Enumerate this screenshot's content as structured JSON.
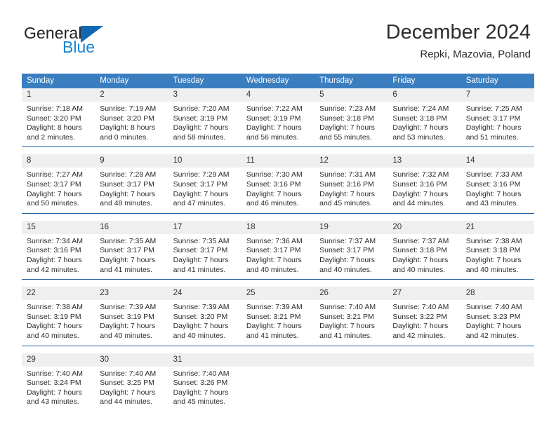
{
  "brand": {
    "name_part1": "General",
    "name_part2": "Blue",
    "triangle_color": "#1267b2",
    "blue_color": "#1982d1"
  },
  "header": {
    "title": "December 2024",
    "location": "Repki, Mazovia, Poland"
  },
  "theme": {
    "header_bg": "#3a7ec0",
    "week_separator": "#1f5fa0",
    "daynum_bg": "#efefef",
    "text": "#2b2b2b"
  },
  "weekdays": [
    "Sunday",
    "Monday",
    "Tuesday",
    "Wednesday",
    "Thursday",
    "Friday",
    "Saturday"
  ],
  "weeks": [
    [
      {
        "day": "1",
        "sunrise": "Sunrise: 7:18 AM",
        "sunset": "Sunset: 3:20 PM",
        "daylight1": "Daylight: 8 hours",
        "daylight2": "and 2 minutes."
      },
      {
        "day": "2",
        "sunrise": "Sunrise: 7:19 AM",
        "sunset": "Sunset: 3:20 PM",
        "daylight1": "Daylight: 8 hours",
        "daylight2": "and 0 minutes."
      },
      {
        "day": "3",
        "sunrise": "Sunrise: 7:20 AM",
        "sunset": "Sunset: 3:19 PM",
        "daylight1": "Daylight: 7 hours",
        "daylight2": "and 58 minutes."
      },
      {
        "day": "4",
        "sunrise": "Sunrise: 7:22 AM",
        "sunset": "Sunset: 3:19 PM",
        "daylight1": "Daylight: 7 hours",
        "daylight2": "and 56 minutes."
      },
      {
        "day": "5",
        "sunrise": "Sunrise: 7:23 AM",
        "sunset": "Sunset: 3:18 PM",
        "daylight1": "Daylight: 7 hours",
        "daylight2": "and 55 minutes."
      },
      {
        "day": "6",
        "sunrise": "Sunrise: 7:24 AM",
        "sunset": "Sunset: 3:18 PM",
        "daylight1": "Daylight: 7 hours",
        "daylight2": "and 53 minutes."
      },
      {
        "day": "7",
        "sunrise": "Sunrise: 7:25 AM",
        "sunset": "Sunset: 3:17 PM",
        "daylight1": "Daylight: 7 hours",
        "daylight2": "and 51 minutes."
      }
    ],
    [
      {
        "day": "8",
        "sunrise": "Sunrise: 7:27 AM",
        "sunset": "Sunset: 3:17 PM",
        "daylight1": "Daylight: 7 hours",
        "daylight2": "and 50 minutes."
      },
      {
        "day": "9",
        "sunrise": "Sunrise: 7:28 AM",
        "sunset": "Sunset: 3:17 PM",
        "daylight1": "Daylight: 7 hours",
        "daylight2": "and 48 minutes."
      },
      {
        "day": "10",
        "sunrise": "Sunrise: 7:29 AM",
        "sunset": "Sunset: 3:17 PM",
        "daylight1": "Daylight: 7 hours",
        "daylight2": "and 47 minutes."
      },
      {
        "day": "11",
        "sunrise": "Sunrise: 7:30 AM",
        "sunset": "Sunset: 3:16 PM",
        "daylight1": "Daylight: 7 hours",
        "daylight2": "and 46 minutes."
      },
      {
        "day": "12",
        "sunrise": "Sunrise: 7:31 AM",
        "sunset": "Sunset: 3:16 PM",
        "daylight1": "Daylight: 7 hours",
        "daylight2": "and 45 minutes."
      },
      {
        "day": "13",
        "sunrise": "Sunrise: 7:32 AM",
        "sunset": "Sunset: 3:16 PM",
        "daylight1": "Daylight: 7 hours",
        "daylight2": "and 44 minutes."
      },
      {
        "day": "14",
        "sunrise": "Sunrise: 7:33 AM",
        "sunset": "Sunset: 3:16 PM",
        "daylight1": "Daylight: 7 hours",
        "daylight2": "and 43 minutes."
      }
    ],
    [
      {
        "day": "15",
        "sunrise": "Sunrise: 7:34 AM",
        "sunset": "Sunset: 3:16 PM",
        "daylight1": "Daylight: 7 hours",
        "daylight2": "and 42 minutes."
      },
      {
        "day": "16",
        "sunrise": "Sunrise: 7:35 AM",
        "sunset": "Sunset: 3:17 PM",
        "daylight1": "Daylight: 7 hours",
        "daylight2": "and 41 minutes."
      },
      {
        "day": "17",
        "sunrise": "Sunrise: 7:35 AM",
        "sunset": "Sunset: 3:17 PM",
        "daylight1": "Daylight: 7 hours",
        "daylight2": "and 41 minutes."
      },
      {
        "day": "18",
        "sunrise": "Sunrise: 7:36 AM",
        "sunset": "Sunset: 3:17 PM",
        "daylight1": "Daylight: 7 hours",
        "daylight2": "and 40 minutes."
      },
      {
        "day": "19",
        "sunrise": "Sunrise: 7:37 AM",
        "sunset": "Sunset: 3:17 PM",
        "daylight1": "Daylight: 7 hours",
        "daylight2": "and 40 minutes."
      },
      {
        "day": "20",
        "sunrise": "Sunrise: 7:37 AM",
        "sunset": "Sunset: 3:18 PM",
        "daylight1": "Daylight: 7 hours",
        "daylight2": "and 40 minutes."
      },
      {
        "day": "21",
        "sunrise": "Sunrise: 7:38 AM",
        "sunset": "Sunset: 3:18 PM",
        "daylight1": "Daylight: 7 hours",
        "daylight2": "and 40 minutes."
      }
    ],
    [
      {
        "day": "22",
        "sunrise": "Sunrise: 7:38 AM",
        "sunset": "Sunset: 3:19 PM",
        "daylight1": "Daylight: 7 hours",
        "daylight2": "and 40 minutes."
      },
      {
        "day": "23",
        "sunrise": "Sunrise: 7:39 AM",
        "sunset": "Sunset: 3:19 PM",
        "daylight1": "Daylight: 7 hours",
        "daylight2": "and 40 minutes."
      },
      {
        "day": "24",
        "sunrise": "Sunrise: 7:39 AM",
        "sunset": "Sunset: 3:20 PM",
        "daylight1": "Daylight: 7 hours",
        "daylight2": "and 40 minutes."
      },
      {
        "day": "25",
        "sunrise": "Sunrise: 7:39 AM",
        "sunset": "Sunset: 3:21 PM",
        "daylight1": "Daylight: 7 hours",
        "daylight2": "and 41 minutes."
      },
      {
        "day": "26",
        "sunrise": "Sunrise: 7:40 AM",
        "sunset": "Sunset: 3:21 PM",
        "daylight1": "Daylight: 7 hours",
        "daylight2": "and 41 minutes."
      },
      {
        "day": "27",
        "sunrise": "Sunrise: 7:40 AM",
        "sunset": "Sunset: 3:22 PM",
        "daylight1": "Daylight: 7 hours",
        "daylight2": "and 42 minutes."
      },
      {
        "day": "28",
        "sunrise": "Sunrise: 7:40 AM",
        "sunset": "Sunset: 3:23 PM",
        "daylight1": "Daylight: 7 hours",
        "daylight2": "and 42 minutes."
      }
    ],
    [
      {
        "day": "29",
        "sunrise": "Sunrise: 7:40 AM",
        "sunset": "Sunset: 3:24 PM",
        "daylight1": "Daylight: 7 hours",
        "daylight2": "and 43 minutes."
      },
      {
        "day": "30",
        "sunrise": "Sunrise: 7:40 AM",
        "sunset": "Sunset: 3:25 PM",
        "daylight1": "Daylight: 7 hours",
        "daylight2": "and 44 minutes."
      },
      {
        "day": "31",
        "sunrise": "Sunrise: 7:40 AM",
        "sunset": "Sunset: 3:26 PM",
        "daylight1": "Daylight: 7 hours",
        "daylight2": "and 45 minutes."
      },
      {
        "day": "",
        "sunrise": "",
        "sunset": "",
        "daylight1": "",
        "daylight2": ""
      },
      {
        "day": "",
        "sunrise": "",
        "sunset": "",
        "daylight1": "",
        "daylight2": ""
      },
      {
        "day": "",
        "sunrise": "",
        "sunset": "",
        "daylight1": "",
        "daylight2": ""
      },
      {
        "day": "",
        "sunrise": "",
        "sunset": "",
        "daylight1": "",
        "daylight2": ""
      }
    ]
  ]
}
